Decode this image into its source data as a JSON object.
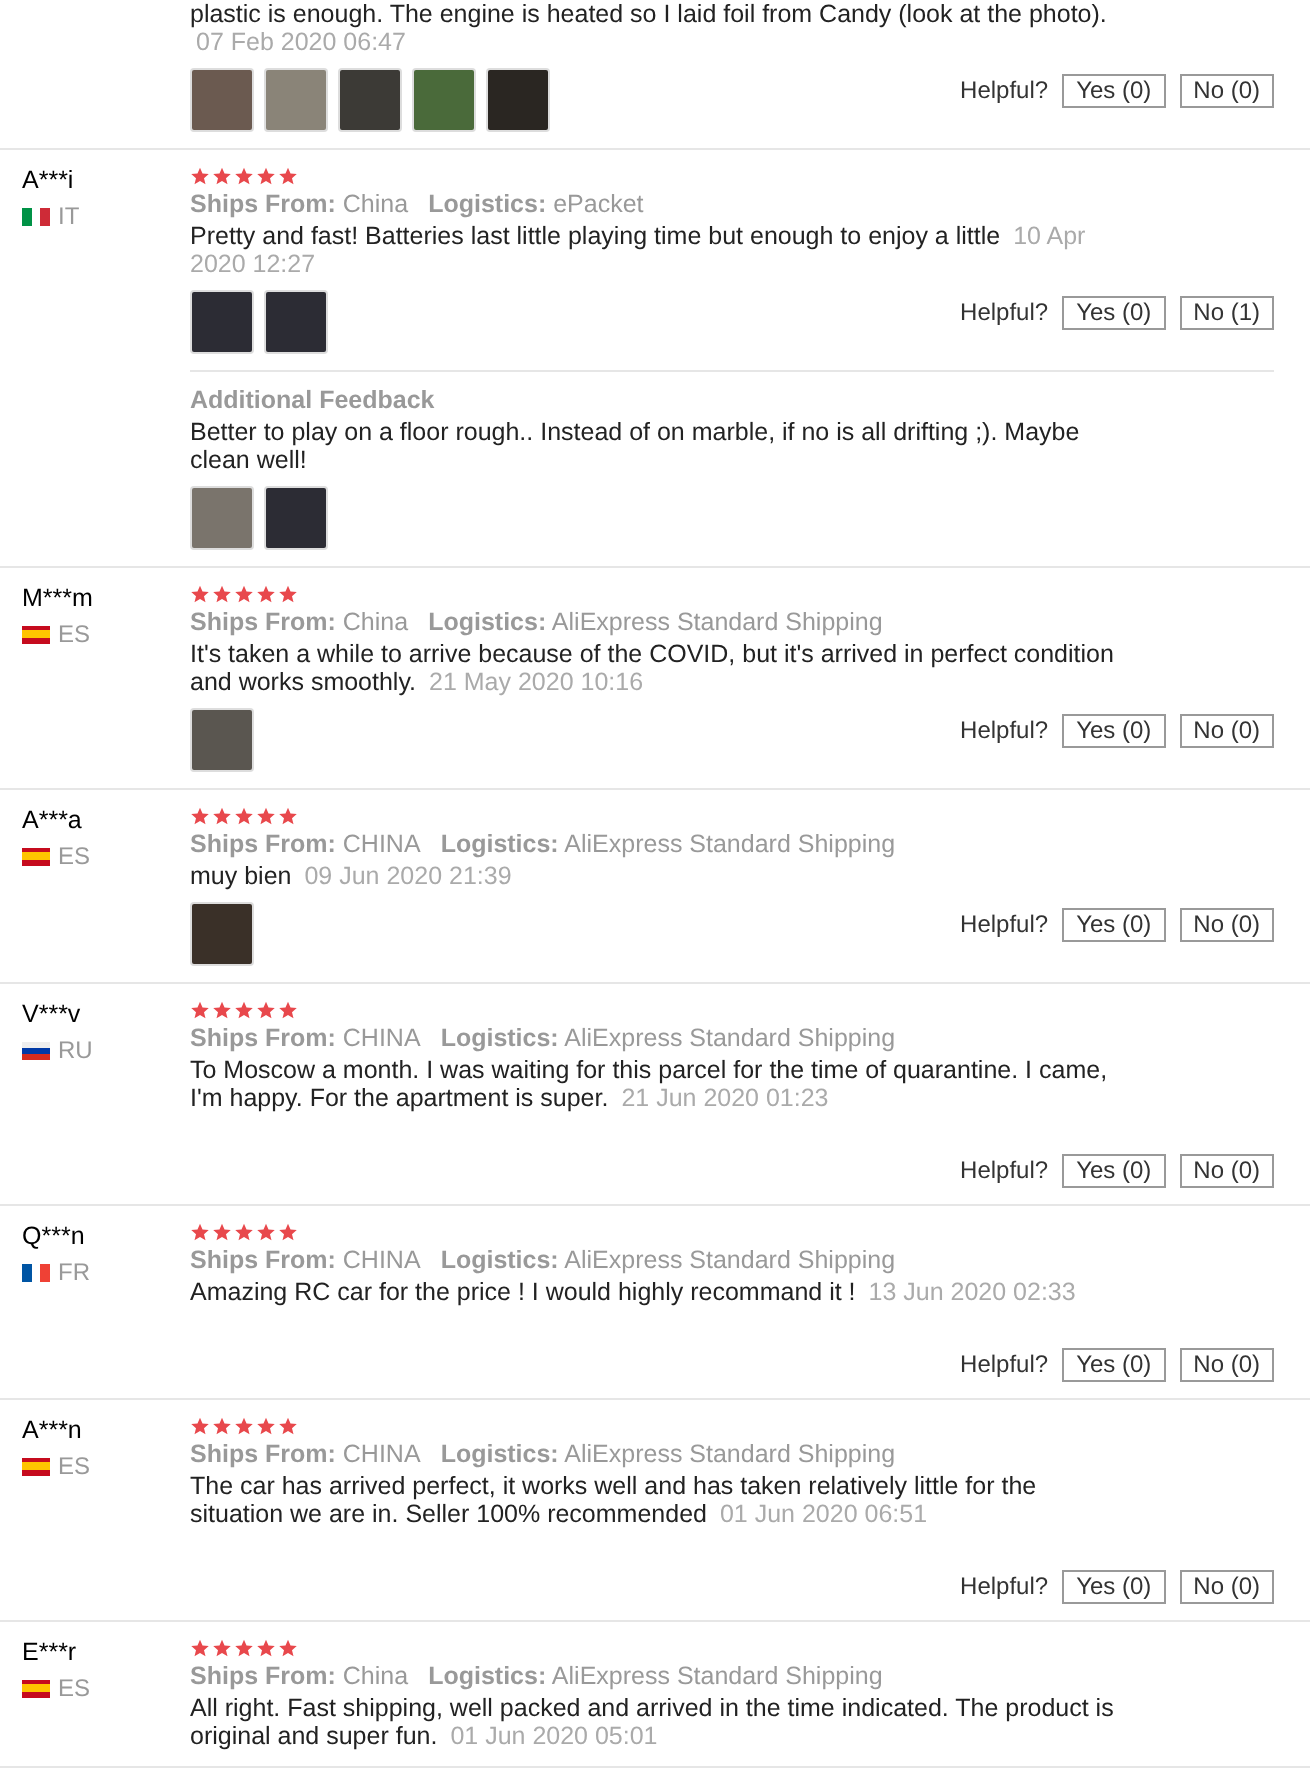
{
  "reviews": [
    {
      "text": "plastic is enough. The engine is heated so I laid foil from Candy (look at the photo).",
      "date": "07 Feb 2020 06:47",
      "photos": [
        {
          "color": "#6b5a50"
        },
        {
          "color": "#8a8478"
        },
        {
          "color": "#3c3a36"
        },
        {
          "color": "#4a6a3a"
        },
        {
          "color": "#2a2622"
        }
      ],
      "helpful_label": "Helpful?",
      "yes": "Yes (0)",
      "no": "No (0)"
    },
    {
      "name": "A***i",
      "flag": {
        "kind": "vertical",
        "stripes": [
          {
            "color": "#009246"
          },
          {
            "color": "#ffffff"
          },
          {
            "color": "#ce2b37"
          }
        ]
      },
      "country": "IT",
      "stars": 5,
      "ships_label": "Ships From:",
      "ships": "China",
      "logistics_label": "Logistics:",
      "logistics": "ePacket",
      "text": "Pretty and fast! Batteries last little playing time but enough to enjoy a little",
      "date": "10 Apr 2020 12:27",
      "photos": [
        {
          "color": "#2c2c34"
        },
        {
          "color": "#2c2c34"
        }
      ],
      "helpful_label": "Helpful?",
      "yes": "Yes (0)",
      "no": "No (1)",
      "additional": {
        "title": "Additional Feedback",
        "text": "Better to play on a floor rough.. Instead of on marble, if no is all drifting ;). Maybe clean well!",
        "photos": [
          {
            "color": "#7a746c"
          },
          {
            "color": "#2c2c34"
          }
        ]
      }
    },
    {
      "name": "M***m",
      "flag": {
        "kind": "banded",
        "stripes": [
          {
            "color": "#c60b1e"
          },
          {
            "color": "#ffc400"
          },
          {
            "color": "#c60b1e"
          }
        ]
      },
      "country": "ES",
      "stars": 5,
      "ships_label": "Ships From:",
      "ships": "China",
      "logistics_label": "Logistics:",
      "logistics": "AliExpress Standard Shipping",
      "text": "It's taken a while to arrive because of the COVID, but it's arrived in perfect condition and works smoothly.",
      "date": "21 May 2020 10:16",
      "photos": [
        {
          "color": "#5a5650"
        }
      ],
      "helpful_label": "Helpful?",
      "yes": "Yes (0)",
      "no": "No (0)"
    },
    {
      "name": "A***a",
      "flag": {
        "kind": "banded",
        "stripes": [
          {
            "color": "#c60b1e"
          },
          {
            "color": "#ffc400"
          },
          {
            "color": "#c60b1e"
          }
        ]
      },
      "country": "ES",
      "stars": 5,
      "ships_label": "Ships From:",
      "ships": "CHINA",
      "logistics_label": "Logistics:",
      "logistics": "AliExpress Standard Shipping",
      "text": "muy bien",
      "date": "09 Jun 2020 21:39",
      "photos": [
        {
          "color": "#3a3028"
        }
      ],
      "helpful_label": "Helpful?",
      "yes": "Yes (0)",
      "no": "No (0)"
    },
    {
      "name": "V***v",
      "flag": {
        "kind": "horizontal",
        "stripes": [
          {
            "color": "#eeeeee"
          },
          {
            "color": "#0039a6"
          },
          {
            "color": "#d52b1e"
          }
        ]
      },
      "country": "RU",
      "stars": 5,
      "ships_label": "Ships From:",
      "ships": "CHINA",
      "logistics_label": "Logistics:",
      "logistics": "AliExpress Standard Shipping",
      "text": "To Moscow a month. I was waiting for this parcel for the time of quarantine. I came, I'm happy. For the apartment is super.",
      "date": "21 Jun 2020 01:23",
      "helpful_label": "Helpful?",
      "yes": "Yes (0)",
      "no": "No (0)"
    },
    {
      "name": "Q***n",
      "flag": {
        "kind": "vertical",
        "stripes": [
          {
            "color": "#0055a4"
          },
          {
            "color": "#ffffff"
          },
          {
            "color": "#ef4135"
          }
        ]
      },
      "country": "FR",
      "stars": 5,
      "ships_label": "Ships From:",
      "ships": "CHINA",
      "logistics_label": "Logistics:",
      "logistics": "AliExpress Standard Shipping",
      "text": "Amazing RC car for the price ! I would highly recommand it !",
      "date": "13 Jun 2020 02:33",
      "helpful_label": "Helpful?",
      "yes": "Yes (0)",
      "no": "No (0)"
    },
    {
      "name": "A***n",
      "flag": {
        "kind": "banded",
        "stripes": [
          {
            "color": "#c60b1e"
          },
          {
            "color": "#ffc400"
          },
          {
            "color": "#c60b1e"
          }
        ]
      },
      "country": "ES",
      "stars": 5,
      "ships_label": "Ships From:",
      "ships": "CHINA",
      "logistics_label": "Logistics:",
      "logistics": "AliExpress Standard Shipping",
      "text": "The car has arrived perfect, it works well and has taken relatively little for the situation we are in. Seller 100% recommended",
      "date": "01 Jun 2020 06:51",
      "helpful_label": "Helpful?",
      "yes": "Yes (0)",
      "no": "No (0)"
    },
    {
      "name": "E***r",
      "flag": {
        "kind": "banded",
        "stripes": [
          {
            "color": "#c60b1e"
          },
          {
            "color": "#ffc400"
          },
          {
            "color": "#c60b1e"
          }
        ]
      },
      "country": "ES",
      "stars": 5,
      "ships_label": "Ships From:",
      "ships": "China",
      "logistics_label": "Logistics:",
      "logistics": "AliExpress Standard Shipping",
      "text": "All right. Fast shipping, well packed and arrived in the time indicated. The product is original and super fun.",
      "date": "01 Jun 2020 05:01"
    }
  ]
}
